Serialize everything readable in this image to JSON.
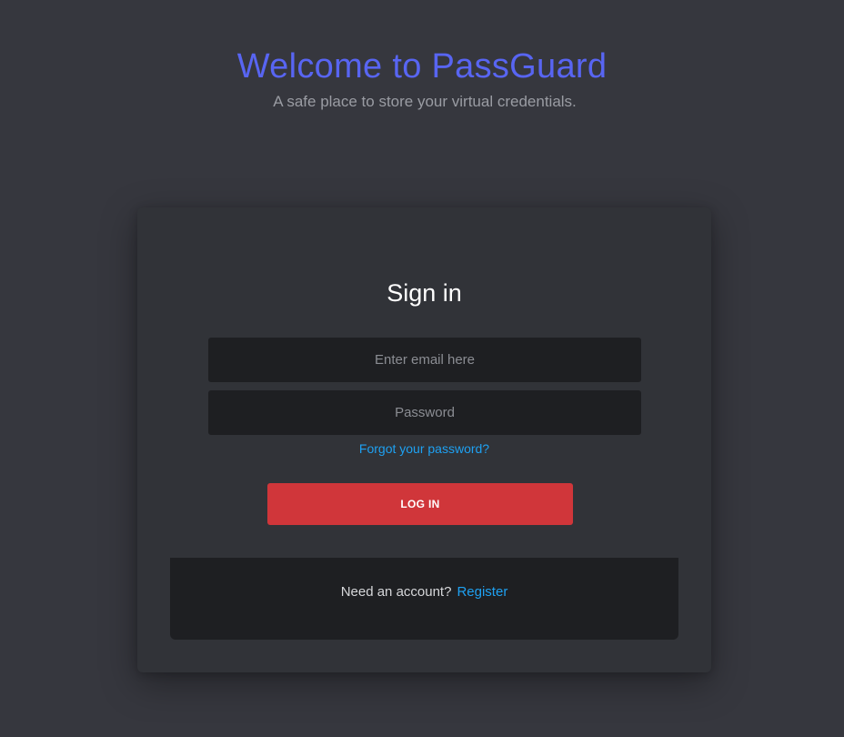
{
  "hero": {
    "title": "Welcome to PassGuard",
    "subtitle": "A safe place to store your virtual credentials."
  },
  "signin": {
    "title": "Sign in",
    "email": {
      "value": "",
      "placeholder": "Enter email here"
    },
    "password": {
      "value": "",
      "placeholder": "Password"
    },
    "forgot_label": "Forgot your password?",
    "login_label": "LOG IN"
  },
  "footer": {
    "prompt": "Need an account?",
    "register_label": "Register"
  },
  "colors": {
    "background": "#36373e",
    "card": "#313338",
    "input": "#1e1f22",
    "title_accent": "#5865f2",
    "link": "#1ea1f2",
    "button": "#d0363a"
  }
}
